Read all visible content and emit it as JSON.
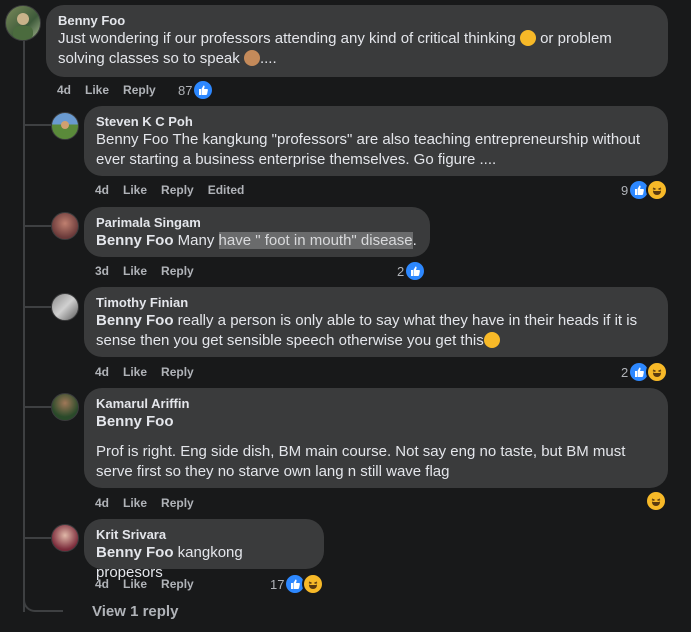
{
  "comments": [
    {
      "author": "Benny Foo",
      "text": "Just wondering if our professors attending any kind of critical thinking",
      "text2": "or problem",
      "text3": "solving classes so to speak",
      "text4": "....",
      "time": "4d",
      "like": "Like",
      "reply": "Reply",
      "reaction_count": "87"
    },
    {
      "author": "Steven K C Poh",
      "text": "Benny Foo The kangkung \"professors\" are also teaching entrepreneurship without ever starting a business enterprise themselves. Go figure ....",
      "time": "4d",
      "like": "Like",
      "reply": "Reply",
      "edited": "Edited",
      "reaction_count": "9"
    },
    {
      "author": "Parimala Singam",
      "mention": "Benny Foo",
      "text_plain": " Many ",
      "text_highlight": "have \" foot in mouth\" disease",
      "text_end": ".",
      "time": "3d",
      "like": "Like",
      "reply": "Reply",
      "reaction_count": "2"
    },
    {
      "author": "Timothy Finian",
      "mention": "Benny Foo",
      "text": " really a person is only able to say what they have in their heads if it is sense then you get sensible speech otherwise you get this",
      "time": "4d",
      "like": "Like",
      "reply": "Reply",
      "reaction_count": "2"
    },
    {
      "author": "Kamarul Ariffin",
      "mention": "Benny Foo",
      "text": "Prof is right. Eng side dish, BM main course. Not say eng no taste, but BM must serve first so they no starve own lang n still wave flag",
      "time": "4d",
      "like": "Like",
      "reply": "Reply"
    },
    {
      "author": "Krit Srivara",
      "mention": "Benny Foo",
      "text": " kangkong propesors",
      "time": "4d",
      "like": "Like",
      "reply": "Reply",
      "reaction_count": "17"
    }
  ],
  "view_reply": "View 1 reply",
  "colors": {
    "background": "#18191a",
    "bubble": "#3a3b3c",
    "like_blue": "#2d88ff",
    "haha_yellow": "#f7b928",
    "muted_text": "#b0b3b8"
  }
}
